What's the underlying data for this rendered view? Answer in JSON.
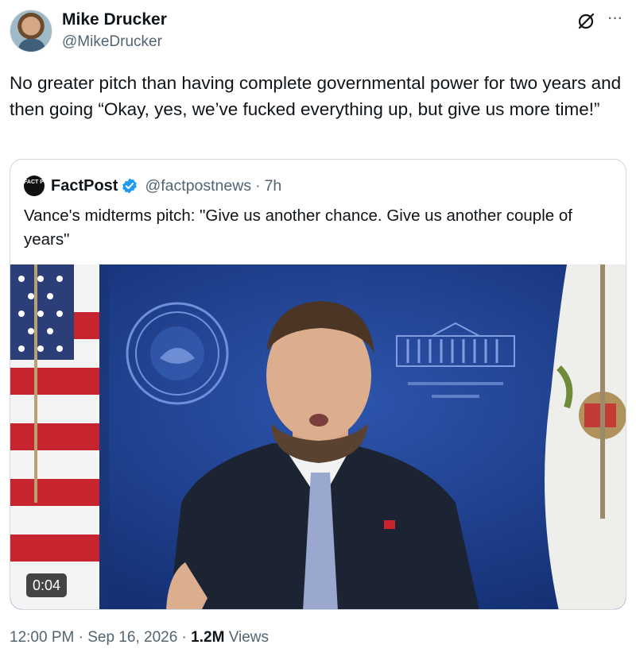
{
  "author": {
    "name": "Mike Drucker",
    "handle": "@MikeDrucker"
  },
  "tweet": {
    "text": "No greater pitch than having complete governmental power for two years and then going “Okay, yes, we’ve fucked everything up, but give us more time!”"
  },
  "quoted": {
    "avatar_text": "FACT POST",
    "name": "FactPost",
    "handle": "@factpostnews",
    "separator": "·",
    "time": "7h",
    "text": "Vance's midterms pitch: \"Give us another chance. Give us another couple of years\"",
    "video": {
      "duration": "0:04"
    }
  },
  "meta": {
    "time": "12:00 PM",
    "separator": "·",
    "date": "Sep 16, 2026",
    "views_count": "1.2M",
    "views_label": "Views"
  },
  "icons": {
    "header_right": [
      "grok-icon",
      "more-icon"
    ],
    "verified": "verified-badge-icon"
  },
  "colors": {
    "text_primary": "#0f1419",
    "text_secondary": "#536471",
    "verified_blue": "#1d9bf0",
    "border": "#cfd9de"
  }
}
